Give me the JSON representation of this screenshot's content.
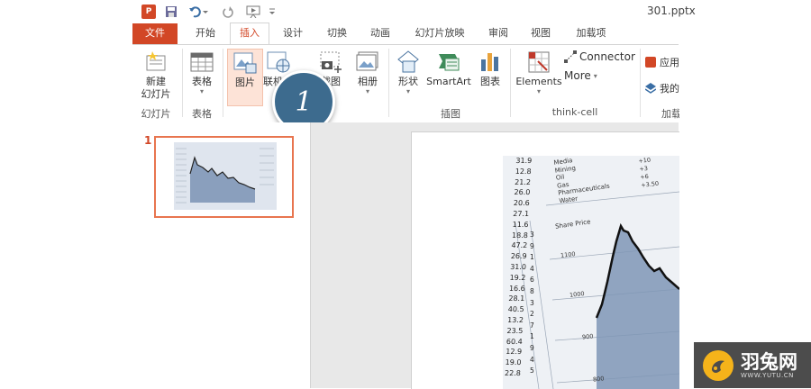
{
  "title_bar": {
    "app_logo": "P",
    "filename": "301.pptx",
    "qat_icons": [
      "powerpoint-logo",
      "save-icon",
      "undo-icon",
      "redo-icon",
      "present-icon",
      "customize-icon"
    ]
  },
  "tabs": [
    "文件",
    "开始",
    "插入",
    "设计",
    "切换",
    "动画",
    "幻灯片放映",
    "审阅",
    "视图",
    "加载项"
  ],
  "active_tab": "插入",
  "ribbon": {
    "new_slide": "新建\n幻灯片",
    "new_slide_line1": "新建",
    "new_slide_line2": "幻灯片",
    "group_slides": "幻灯片",
    "table": "表格",
    "group_tables": "表格",
    "picture": "图片",
    "online_picture": "联机",
    "screenshot": "截图",
    "album": "相册",
    "shapes": "形状",
    "smartart": "SmartArt",
    "chart": "图表",
    "group_illustrations": "插图",
    "elements": "Elements",
    "connector": "Connector",
    "more": "More",
    "group_thinkcell": "think-cell",
    "app_store": "应用",
    "my_apps": "我的",
    "group_addins": "加载"
  },
  "step_badge": "1",
  "slides_pane": {
    "slide_number": "1"
  },
  "stock_figures": {
    "labels": [
      "Media",
      "Mining",
      "Oil",
      "Gas",
      "Pharmaceuticals",
      "Water"
    ],
    "chart_title": "Share Price",
    "axis_values": [
      "1100",
      "1000",
      "900",
      "800"
    ],
    "left_column": [
      "31.9",
      "12.8",
      "21.2",
      "26.0",
      "20.6",
      "27.1",
      "11.6",
      "18.8",
      "47.2",
      "26.9",
      "31.0",
      "19.2",
      "16.6",
      "28.1",
      "40.5",
      "13.2",
      "23.5",
      "60.4",
      "12.9",
      "19.0",
      "22.8"
    ],
    "second_column": [
      "3",
      "9",
      "1",
      "4",
      "6",
      "8",
      "3",
      "2",
      "7",
      "1",
      "9",
      "4",
      "5"
    ],
    "right_values": [
      "+10",
      "+3",
      "+6",
      "+3.50"
    ]
  },
  "watermark": {
    "name": "羽兔网",
    "url": "WWW.YUTU.CN"
  },
  "colors": {
    "accent": "#d24726",
    "badge": "#3d6b8e",
    "thumb_border": "#e8754f",
    "watermark_bg": "#4c4c4c",
    "watermark_logo": "#f5b31a"
  }
}
